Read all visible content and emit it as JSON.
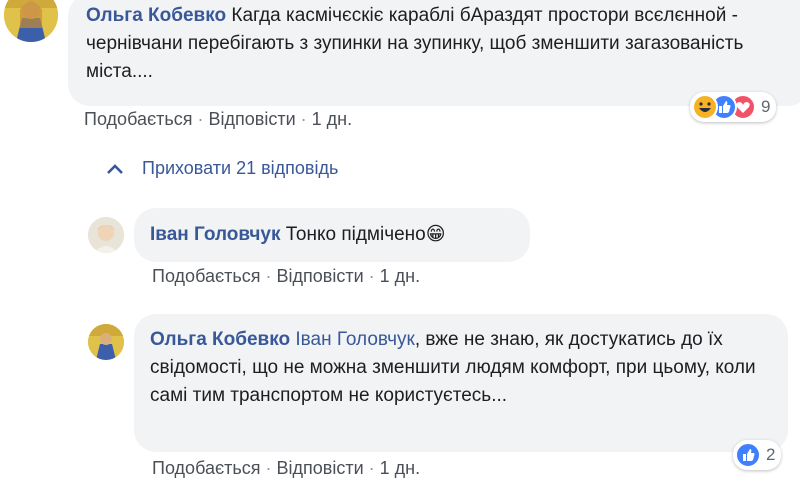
{
  "comments": [
    {
      "author": "Ольга Кобевко",
      "text": "Кагда касмічєскіє караблі бАраздят простори всєлєнной - чернівчани перебігають з зупинки на зупинку, щоб зменшити загазованість міста....",
      "actions": {
        "like": "Подобається",
        "reply": "Відповісти",
        "time": "1 дн."
      },
      "reactions": {
        "icons": [
          "haha-icon",
          "like-icon",
          "love-icon"
        ],
        "count": "9"
      }
    }
  ],
  "replies_toggle": {
    "label": "Приховати 21 відповідь"
  },
  "replies": [
    {
      "author": "Іван Головчук",
      "text": "Тонко підмічено",
      "emoji": "😁",
      "actions": {
        "like": "Подобається",
        "reply": "Відповісти",
        "time": "1 дн."
      }
    },
    {
      "author": "Ольга Кобевко",
      "mention": "Іван Головчук",
      "text": ", вже не знаю, як достукатись до їх свідомості, що не можна зменшити людям комфорт, при цьому, коли самі тим транспортом не користуєтесь...",
      "actions": {
        "like": "Подобається",
        "reply": "Відповісти",
        "time": "1 дн."
      },
      "reactions": {
        "icons": [
          "like-icon"
        ],
        "count": "2"
      }
    }
  ]
}
